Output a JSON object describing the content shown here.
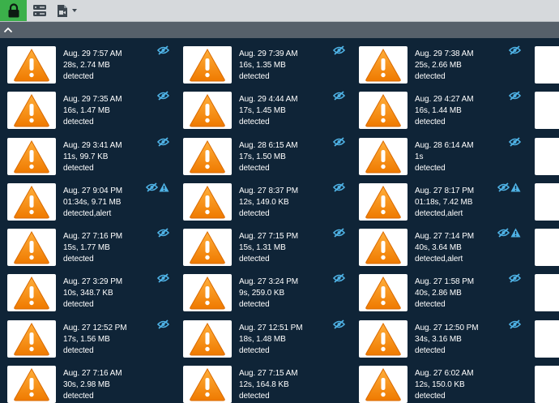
{
  "colors": {
    "accent": "#3bb04a",
    "background": "#0f2437",
    "icon_blue": "#4fb3e6",
    "warning_orange": "#f5860e"
  },
  "toolbar": {
    "lock_icon": "lock-icon",
    "server_icon": "server-icon",
    "camera_icon": "video-file-icon",
    "dropdown_icon": "caret-down-icon"
  },
  "subbar": {
    "collapse_icon": "chevron-up-icon"
  },
  "events": [
    {
      "time": "Aug. 29 7:57 AM",
      "info": "28s, 2.74 MB",
      "tags": "detected",
      "hidden": true,
      "alert": false
    },
    {
      "time": "Aug. 29 7:39 AM",
      "info": "16s, 1.35 MB",
      "tags": "detected",
      "hidden": true,
      "alert": false
    },
    {
      "time": "Aug. 29 7:38 AM",
      "info": "25s, 2.66 MB",
      "tags": "detected",
      "hidden": true,
      "alert": false
    },
    {
      "time": "Aug. 29 7:35 AM",
      "info": "16s, 1.47 MB",
      "tags": "detected",
      "hidden": true,
      "alert": false
    },
    {
      "time": "Aug. 29 4:44 AM",
      "info": "17s, 1.45 MB",
      "tags": "detected",
      "hidden": true,
      "alert": false
    },
    {
      "time": "Aug. 29 4:27 AM",
      "info": "16s, 1.44 MB",
      "tags": "detected",
      "hidden": true,
      "alert": false
    },
    {
      "time": "Aug. 29 3:41 AM",
      "info": "11s, 99.7 KB",
      "tags": "detected",
      "hidden": true,
      "alert": false
    },
    {
      "time": "Aug. 28 6:15 AM",
      "info": "17s, 1.50 MB",
      "tags": "detected",
      "hidden": true,
      "alert": false
    },
    {
      "time": "Aug. 28 6:14 AM",
      "info": "1s",
      "tags": "detected",
      "hidden": true,
      "alert": false
    },
    {
      "time": "Aug. 27 9:04 PM",
      "info": "01:34s, 9.71 MB",
      "tags": "detected,alert",
      "hidden": true,
      "alert": true
    },
    {
      "time": "Aug. 27 8:37 PM",
      "info": "12s, 149.0 KB",
      "tags": "detected",
      "hidden": true,
      "alert": false
    },
    {
      "time": "Aug. 27 8:17 PM",
      "info": "01:18s, 7.42 MB",
      "tags": "detected,alert",
      "hidden": true,
      "alert": true
    },
    {
      "time": "Aug. 27 7:16 PM",
      "info": "15s, 1.77 MB",
      "tags": "detected",
      "hidden": true,
      "alert": false
    },
    {
      "time": "Aug. 27 7:15 PM",
      "info": "15s, 1.31 MB",
      "tags": "detected",
      "hidden": true,
      "alert": false
    },
    {
      "time": "Aug. 27 7:14 PM",
      "info": "40s, 3.64 MB",
      "tags": "detected,alert",
      "hidden": true,
      "alert": true
    },
    {
      "time": "Aug. 27 3:29 PM",
      "info": "10s, 348.7 KB",
      "tags": "detected",
      "hidden": true,
      "alert": false
    },
    {
      "time": "Aug. 27 3:24 PM",
      "info": "9s, 259.0 KB",
      "tags": "detected",
      "hidden": true,
      "alert": false
    },
    {
      "time": "Aug. 27 1:58 PM",
      "info": "40s, 2.86 MB",
      "tags": "detected",
      "hidden": true,
      "alert": false
    },
    {
      "time": "Aug. 27 12:52 PM",
      "info": "17s, 1.56 MB",
      "tags": "detected",
      "hidden": true,
      "alert": false
    },
    {
      "time": "Aug. 27 12:51 PM",
      "info": "18s, 1.48 MB",
      "tags": "detected",
      "hidden": true,
      "alert": false
    },
    {
      "time": "Aug. 27 12:50 PM",
      "info": "34s, 3.16 MB",
      "tags": "detected",
      "hidden": true,
      "alert": false
    },
    {
      "time": "Aug. 27 7:16 AM",
      "info": "30s, 2.98 MB",
      "tags": "detected",
      "hidden": false,
      "alert": false
    },
    {
      "time": "Aug. 27 7:15 AM",
      "info": "12s, 164.8 KB",
      "tags": "detected",
      "hidden": false,
      "alert": false
    },
    {
      "time": "Aug. 27 6:02 AM",
      "info": "12s, 150.0 KB",
      "tags": "detected",
      "hidden": false,
      "alert": false
    }
  ]
}
